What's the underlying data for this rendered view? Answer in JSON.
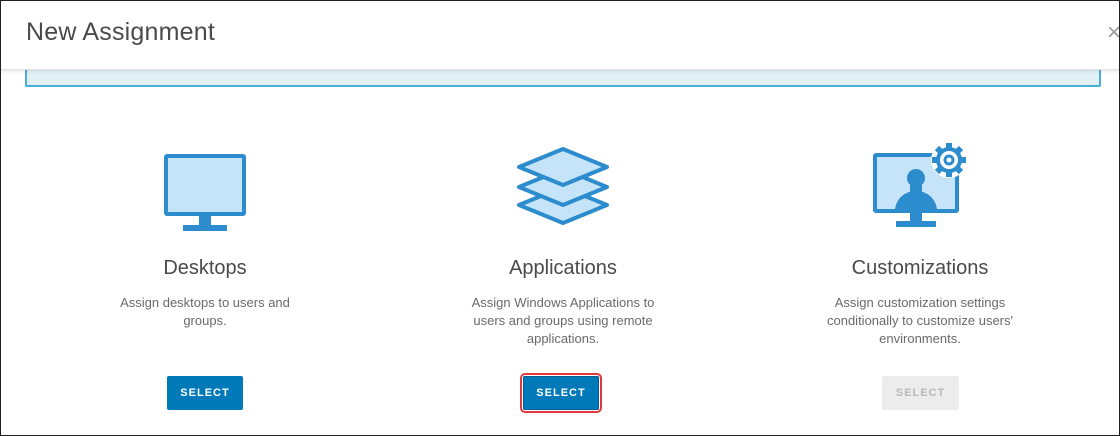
{
  "modal": {
    "title": "New Assignment",
    "close_glyph": "×"
  },
  "cards": [
    {
      "title": "Desktops",
      "description": "Assign desktops to users and groups.",
      "button_label": "SELECT",
      "icon": "desktop-monitor-icon",
      "button_state": "enabled"
    },
    {
      "title": "Applications",
      "description": "Assign Windows Applications to users and groups using remote applications.",
      "button_label": "SELECT",
      "icon": "layers-stack-icon",
      "button_state": "enabled-highlighted"
    },
    {
      "title": "Customizations",
      "description": "Assign customization settings conditionally to customize users' environments.",
      "button_label": "SELECT",
      "icon": "user-settings-monitor-icon",
      "button_state": "disabled"
    }
  ],
  "colors": {
    "primary": "#0079b8",
    "icon_stroke": "#2d8ccd",
    "icon_fill": "#c6e4f9",
    "info_border": "#49afd9",
    "highlight": "#e0393e"
  }
}
